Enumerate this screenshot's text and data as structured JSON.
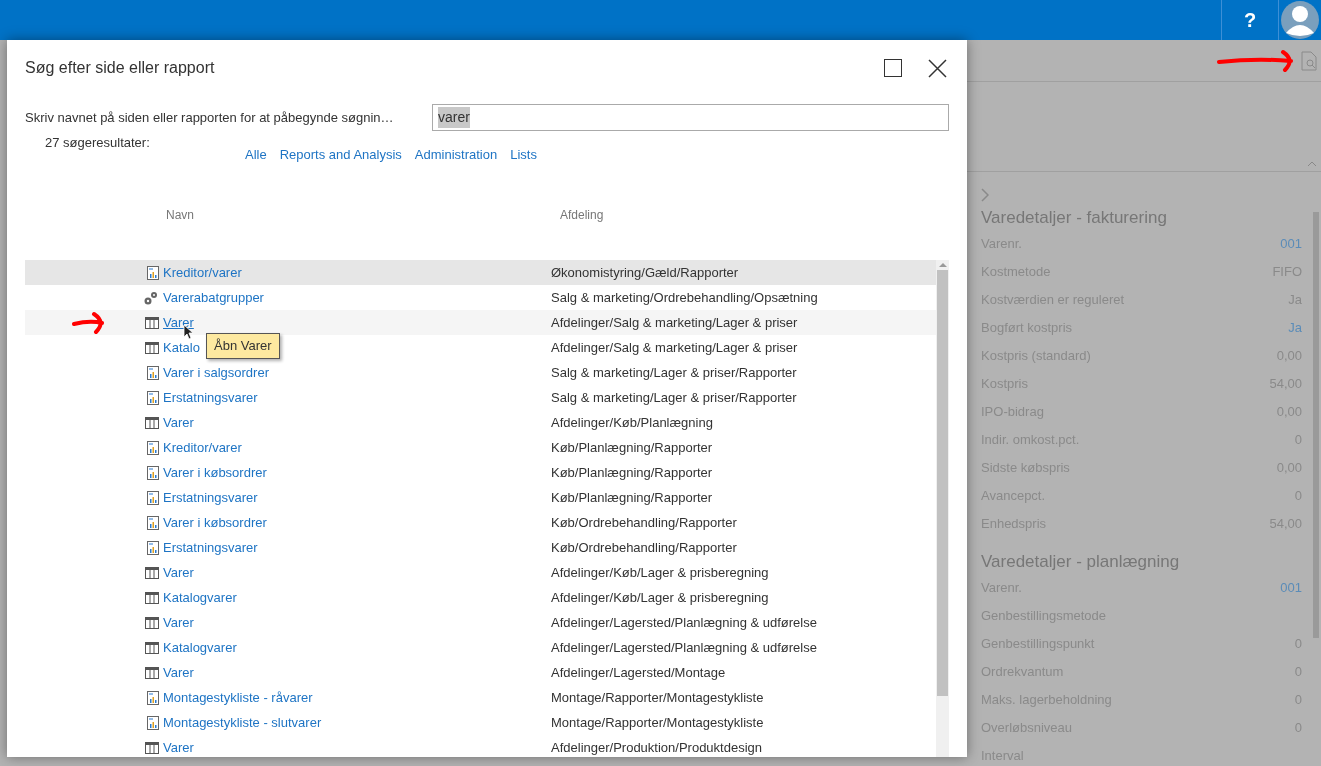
{
  "top_bar": {
    "help": "?"
  },
  "background_panel": {
    "sections": [
      {
        "title": "Varedetaljer - fakturering",
        "fields": [
          {
            "label": "Varenr.",
            "value": "001",
            "color": "#5b8cb8"
          },
          {
            "label": "Kostmetode",
            "value": "FIFO"
          },
          {
            "label": "Kostværdien er reguleret",
            "value": "Ja"
          },
          {
            "label": "Bogført kostpris",
            "value": "Ja",
            "color": "#5b8cb8"
          },
          {
            "label": "Kostpris (standard)",
            "value": "0,00"
          },
          {
            "label": "Kostpris",
            "value": "54,00"
          },
          {
            "label": "IPO-bidrag",
            "value": "0,00"
          },
          {
            "label": "Indir. omkost.pct.",
            "value": "0"
          },
          {
            "label": "Sidste købspris",
            "value": "0,00"
          },
          {
            "label": "Avancepct.",
            "value": "0"
          },
          {
            "label": "Enhedspris",
            "value": "54,00"
          }
        ]
      },
      {
        "title": "Varedetaljer - planlægning",
        "fields": [
          {
            "label": "Varenr.",
            "value": "001",
            "color": "#5b8cb8"
          },
          {
            "label": "Genbestillingsmetode"
          },
          {
            "label": "Genbestillingspunkt",
            "value": "0"
          },
          {
            "label": "Ordrekvantum",
            "value": "0"
          },
          {
            "label": "Maks. lagerbeholdning",
            "value": "0"
          },
          {
            "label": "Overløbsniveau",
            "value": "0"
          },
          {
            "label": "Interval"
          }
        ]
      }
    ]
  },
  "dialog": {
    "title": "Søg efter side eller rapport",
    "prompt": "Skriv navnet på siden eller rapporten for at påbegynde søgnin…",
    "search": {
      "value": "varer"
    },
    "result_count": "27 søgeresultater:",
    "filters": [
      "Alle",
      "Reports and Analysis",
      "Administration",
      "Lists"
    ],
    "columns": [
      "Navn",
      "Afdeling"
    ],
    "rows": [
      {
        "kind": "report",
        "name": "Kreditor/varer",
        "department": "Økonomistyring/Gæld/Rapporter",
        "selected": true,
        "hover": false
      },
      {
        "kind": "setup",
        "name": "Varerabatgrupper",
        "department": "Salg & marketing/Ordrebehandling/Opsætning",
        "selected": false,
        "hover": false
      },
      {
        "kind": "list",
        "name": "Varer",
        "department": "Afdelinger/Salg & marketing/Lager & priser",
        "selected": false,
        "hover": true
      },
      {
        "kind": "list",
        "name": "Katalo",
        "department": "Afdelinger/Salg & marketing/Lager & priser",
        "selected": false,
        "hover": false
      },
      {
        "kind": "report",
        "name": "Varer i salgsordrer",
        "department": "Salg & marketing/Lager & priser/Rapporter",
        "selected": false,
        "hover": false
      },
      {
        "kind": "report",
        "name": "Erstatningsvarer",
        "department": "Salg & marketing/Lager & priser/Rapporter",
        "selected": false,
        "hover": false
      },
      {
        "kind": "list",
        "name": "Varer",
        "department": "Afdelinger/Køb/Planlægning",
        "selected": false,
        "hover": false
      },
      {
        "kind": "report",
        "name": "Kreditor/varer",
        "department": "Køb/Planlægning/Rapporter",
        "selected": false,
        "hover": false
      },
      {
        "kind": "report",
        "name": "Varer i købsordrer",
        "department": "Køb/Planlægning/Rapporter",
        "selected": false,
        "hover": false
      },
      {
        "kind": "report",
        "name": "Erstatningsvarer",
        "department": "Køb/Planlægning/Rapporter",
        "selected": false,
        "hover": false
      },
      {
        "kind": "report",
        "name": "Varer i købsordrer",
        "department": "Køb/Ordrebehandling/Rapporter",
        "selected": false,
        "hover": false
      },
      {
        "kind": "report",
        "name": "Erstatningsvarer",
        "department": "Køb/Ordrebehandling/Rapporter",
        "selected": false,
        "hover": false
      },
      {
        "kind": "list",
        "name": "Varer",
        "department": "Afdelinger/Køb/Lager & prisberegning",
        "selected": false,
        "hover": false
      },
      {
        "kind": "list",
        "name": "Katalogvarer",
        "department": "Afdelinger/Køb/Lager & prisberegning",
        "selected": false,
        "hover": false
      },
      {
        "kind": "list",
        "name": "Varer",
        "department": "Afdelinger/Lagersted/Planlægning & udførelse",
        "selected": false,
        "hover": false
      },
      {
        "kind": "list",
        "name": "Katalogvarer",
        "department": "Afdelinger/Lagersted/Planlægning & udførelse",
        "selected": false,
        "hover": false
      },
      {
        "kind": "list",
        "name": "Varer",
        "department": "Afdelinger/Lagersted/Montage",
        "selected": false,
        "hover": false
      },
      {
        "kind": "report",
        "name": "Montagestykliste - råvarer",
        "department": "Montage/Rapporter/Montagestykliste",
        "selected": false,
        "hover": false
      },
      {
        "kind": "report",
        "name": "Montagestykliste - slutvarer",
        "department": "Montage/Rapporter/Montagestykliste",
        "selected": false,
        "hover": false
      },
      {
        "kind": "list",
        "name": "Varer",
        "department": "Afdelinger/Produktion/Produktdesign",
        "selected": false,
        "hover": false
      }
    ],
    "tooltip": "Åbn Varer"
  }
}
